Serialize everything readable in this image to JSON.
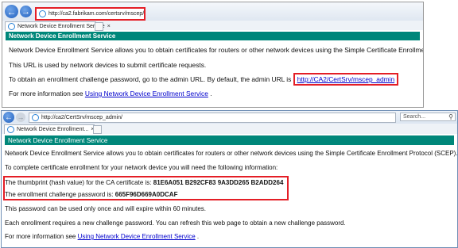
{
  "window1": {
    "url": "http://ca2.fabrikam.com/certsrv/mscep/",
    "tab_title": "Network Device Enrollment Service",
    "banner": "Network Device Enrollment Service",
    "para1": "Network Device Enrollment Service allows you to obtain certificates for routers or other network devices using the Simple Certificate Enrollment Protoc",
    "para2": "This URL is used by network devices to submit certificate requests.",
    "para3_prefix": "To obtain an enrollment challenge password, go to the admin URL. By default, the admin URL is ",
    "admin_link": "http://CA2/CertSrv/mscep_admin",
    "para4_prefix": "For more information see ",
    "more_link": "Using Network Device Enrollment Service",
    "para4_suffix": " ."
  },
  "window2": {
    "url": "http://ca2/CertSrv/mscep_admin/",
    "search_label": "Search...",
    "tab_title": "Network Device Enrollment...",
    "banner": "Network Device Enrollment Service",
    "para1": "Network Device Enrollment Service allows you to obtain certificates for routers or other network devices using the Simple Certificate Enrollment Protocol (SCEP).",
    "para2": "To complete certificate enrollment for your network device you will need the following information:",
    "thumb_label": "The thumbprint (hash value) for the CA certificate is: ",
    "thumb_value": "81E6A051 B292CF83 9A3DD265 B2ADD264",
    "pwd_label": "The enrollment challenge password is: ",
    "pwd_value": "665F96D669A0DCAF",
    "para3": "This password can be used only once and will expire within 60 minutes.",
    "para4": "Each enrollment requires a new challenge password. You can refresh this web page to obtain a new challenge password.",
    "para5_prefix": "For more information see ",
    "more_link": "Using Network Device Enrollment Service",
    "para5_suffix": " ."
  }
}
